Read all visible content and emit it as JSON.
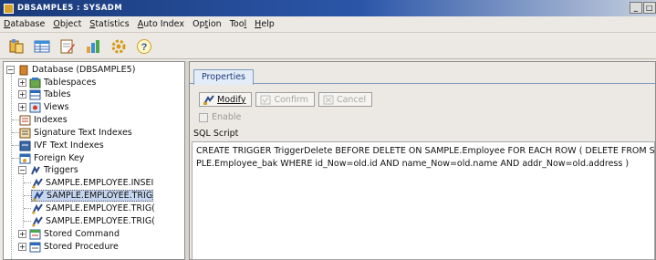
{
  "window": {
    "title": "DBSAMPLE5 : SYSADM",
    "controls": [
      "_",
      "□"
    ]
  },
  "menu": [
    {
      "pre": "",
      "u": "D",
      "post": "atabase"
    },
    {
      "pre": "",
      "u": "O",
      "post": "bject"
    },
    {
      "pre": "",
      "u": "S",
      "post": "tatistics"
    },
    {
      "pre": "",
      "u": "A",
      "post": "uto Index"
    },
    {
      "pre": "Op",
      "u": "t",
      "post": "ion"
    },
    {
      "pre": "Too",
      "u": "l",
      "post": ""
    },
    {
      "pre": "",
      "u": "H",
      "post": "elp"
    }
  ],
  "toolbar_icons": [
    "connect-icon",
    "table-icon",
    "edit-icon",
    "chart-icon",
    "settings-icon",
    "help-icon"
  ],
  "tree": {
    "root": "Database (DBSAMPLE5)",
    "items": [
      {
        "label": "Tablespaces"
      },
      {
        "label": "Tables"
      },
      {
        "label": "Views"
      },
      {
        "label": "Indexes"
      },
      {
        "label": "Signature Text Indexes"
      },
      {
        "label": "IVF Text Indexes"
      },
      {
        "label": "Foreign Key"
      },
      {
        "label": "Triggers"
      },
      {
        "label": "SAMPLE.EMPLOYEE.INSEI"
      },
      {
        "label": "SAMPLE.EMPLOYEE.TRIG"
      },
      {
        "label": "SAMPLE.EMPLOYEE.TRIG("
      },
      {
        "label": "SAMPLE.EMPLOYEE.TRIG("
      },
      {
        "label": "Stored Command"
      },
      {
        "label": "Stored Procedure"
      }
    ]
  },
  "panel": {
    "tab": "Properties",
    "buttons": {
      "modify": "Modify",
      "confirm": "Confirm",
      "cancel": "Cancel"
    },
    "enable_label": "Enable",
    "sql_label": "SQL Script",
    "sql_lines": [
      "CREATE TRIGGER TriggerDelete BEFORE DELETE ON SAMPLE.Employee FOR EACH ROW ( DELETE FROM SAM",
      "PLE.Employee_bak WHERE id_Now=old.id AND name_Now=old.name AND addr_Now=old.address )"
    ]
  }
}
